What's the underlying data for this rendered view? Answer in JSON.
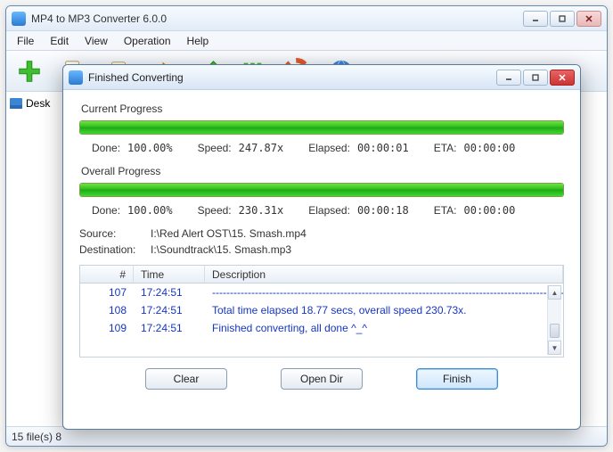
{
  "main": {
    "title": "MP4 to MP3 Converter 6.0.0",
    "menu": [
      "File",
      "Edit",
      "View",
      "Operation",
      "Help"
    ],
    "tree": {
      "item0": "Desk"
    },
    "status": "15 file(s)    8"
  },
  "dialog": {
    "title": "Finished Converting",
    "current": {
      "label": "Current Progress",
      "done_label": "Done:",
      "done_val": "100.00%",
      "speed_label": "Speed:",
      "speed_val": "247.87x",
      "elapsed_label": "Elapsed:",
      "elapsed_val": "00:00:01",
      "eta_label": "ETA:",
      "eta_val": "00:00:00"
    },
    "overall": {
      "label": "Overall Progress",
      "done_label": "Done:",
      "done_val": "100.00%",
      "speed_label": "Speed:",
      "speed_val": "230.31x",
      "elapsed_label": "Elapsed:",
      "elapsed_val": "00:00:18",
      "eta_label": "ETA:",
      "eta_val": "00:00:00"
    },
    "source_label": "Source:",
    "source_val": "I:\\Red Alert OST\\15. Smash.mp4",
    "dest_label": "Destination:",
    "dest_val": "I:\\Soundtrack\\15. Smash.mp3",
    "cols": {
      "n": "#",
      "t": "Time",
      "d": "Description"
    },
    "rows": [
      {
        "n": "107",
        "t": "17:24:51",
        "d": "--------------------------------------------------------------------------------------------------------"
      },
      {
        "n": "108",
        "t": "17:24:51",
        "d": "Total time elapsed 18.77 secs, overall speed 230.73x."
      },
      {
        "n": "109",
        "t": "17:24:51",
        "d": "Finished converting, all done ^_^"
      }
    ],
    "buttons": {
      "clear": "Clear",
      "open_dir": "Open Dir",
      "finish": "Finish"
    }
  }
}
